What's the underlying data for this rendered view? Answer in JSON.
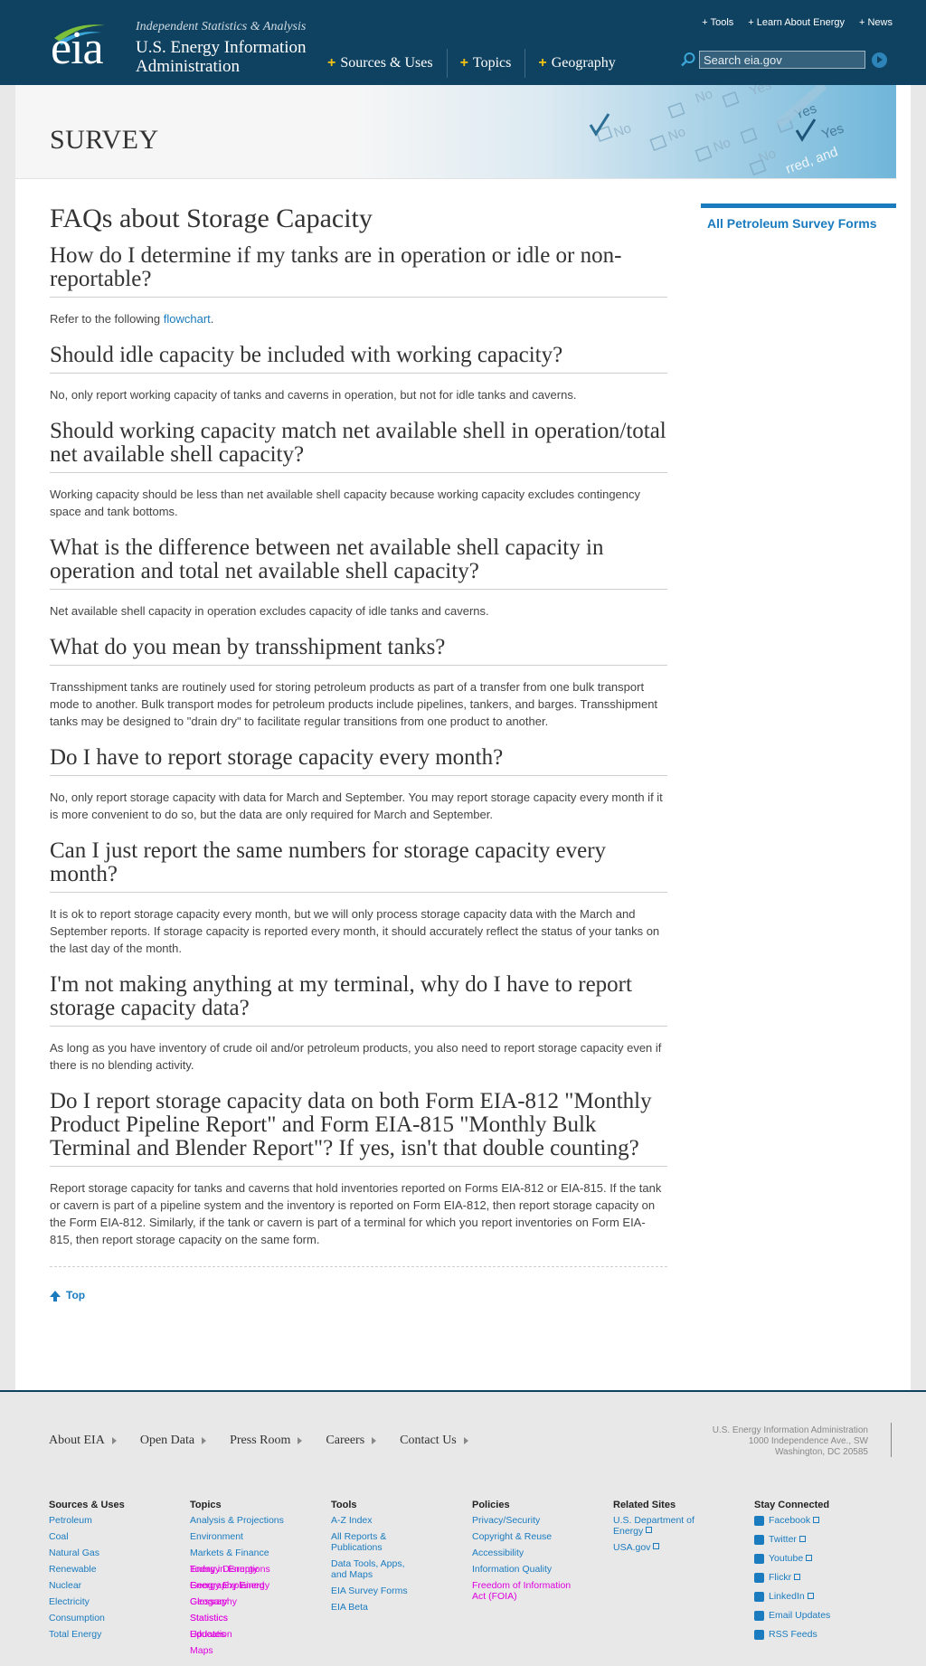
{
  "header": {
    "logo_text": "eia",
    "tagline": "Independent Statistics & Analysis",
    "org_name": "U.S. Energy Information Administration",
    "main_nav": [
      "Sources & Uses",
      "Topics",
      "Geography"
    ],
    "util_nav": [
      "Tools",
      "Learn About Energy",
      "News"
    ],
    "search_placeholder": "Search eia.gov"
  },
  "banner": {
    "title": "SURVEY"
  },
  "page_title": "FAQs about Storage Capacity",
  "faqs": [
    {
      "q": "How do I determine if my tanks are in operation or idle or non-reportable?",
      "a_prefix": "Refer to the following ",
      "a_link": "flowchart",
      "a_suffix": "."
    },
    {
      "q": "Should idle capacity be included with working capacity?",
      "a": "No, only report working capacity of tanks and caverns in operation, but not for idle tanks and caverns."
    },
    {
      "q": "Should working capacity match net available shell in operation/total net available shell capacity?",
      "a": "Working capacity should be less than net available shell capacity because working capacity excludes contingency space and tank bottoms."
    },
    {
      "q": "What is the difference between net available shell capacity in operation and total net available shell capacity?",
      "a": "Net available shell capacity in operation excludes capacity of idle tanks and caverns."
    },
    {
      "q": "What do you mean by transshipment tanks?",
      "a": "Transshipment tanks are routinely used for storing petroleum products as part of a transfer from one bulk transport mode to another. Bulk transport modes for petroleum products include pipelines, tankers, and barges. Transshipment tanks may be designed to \"drain dry\" to facilitate regular transitions from one product to another."
    },
    {
      "q": "Do I have to report storage capacity every month?",
      "a": "No, only report storage capacity with data for March and September. You may report storage capacity every month if it is more convenient to do so, but the data are only required for March and September."
    },
    {
      "q": "Can I just report the same numbers for storage capacity every month?",
      "a": "It is ok to report storage capacity every month, but we will only process storage capacity data with the March and September reports. If storage capacity is reported every month, it should accurately reflect the status of your tanks on the last day of the month."
    },
    {
      "q": "I'm not making anything at my terminal, why do I have to report storage capacity data?",
      "a": "As long as you have inventory of crude oil and/or petroleum products, you also need to report storage capacity even if there is no blending activity."
    },
    {
      "q": "Do I report storage capacity data on both Form EIA-812 \"Monthly Product Pipeline Report\" and Form EIA-815 \"Monthly Bulk Terminal and Blender Report\"? If yes, isn't that double counting?",
      "a": "Report storage capacity for tanks and caverns that hold inventories reported on Forms EIA-812 or EIA-815. If the tank or cavern is part of a pipeline system and the inventory is reported on Form EIA-812, then report storage capacity on the Form EIA-812. Similarly, if the tank or cavern is part of a terminal for which you report inventories on Form EIA-815, then report storage capacity on the same form."
    }
  ],
  "top_link": "Top",
  "sidebar": {
    "link": "All Petroleum Survey Forms"
  },
  "footer": {
    "nav": [
      "About EIA",
      "Open Data",
      "Press Room",
      "Careers",
      "Contact Us"
    ],
    "address": [
      "U.S. Energy Information Administration",
      "1000 Independence Ave., SW",
      "Washington, DC 20585"
    ],
    "sources": {
      "title": "Sources & Uses",
      "links": [
        "Petroleum",
        "Coal",
        "Natural Gas",
        "Renewable",
        "Nuclear",
        "Electricity",
        "Consumption",
        "Total Energy"
      ]
    },
    "topics": {
      "title": "Topics",
      "links": [
        "Analysis & Projections",
        "Environment",
        "Markets & Finance"
      ],
      "overlaps": [
        [
          "Today in Energy",
          "Energy Disruptions"
        ],
        [
          "Energy Explained",
          "Geography Energy"
        ],
        [
          "Geography",
          "Glossary"
        ],
        [
          "Statistics",
          "Statistics"
        ],
        [
          "Education",
          "Updates"
        ],
        [
          "Maps"
        ]
      ]
    },
    "tools": {
      "title": "Tools",
      "links": [
        "A-Z Index",
        "All Reports & Publications",
        "Data Tools, Apps, and Maps",
        "EIA Survey Forms",
        "EIA Beta"
      ]
    },
    "policies": {
      "title": "Policies",
      "links": [
        "Privacy/Security",
        "Copyright & Reuse",
        "Accessibility",
        "Information Quality"
      ],
      "extra": "Freedom of Information Act (FOIA)"
    },
    "related": {
      "title": "Related Sites",
      "links": [
        "U.S. Department of Energy",
        "USA.gov"
      ]
    },
    "social": {
      "title": "Stay Connected",
      "links": [
        "Facebook",
        "Twitter",
        "Youtube",
        "Flickr",
        "LinkedIn",
        "Email Updates",
        "RSS Feeds"
      ]
    }
  }
}
